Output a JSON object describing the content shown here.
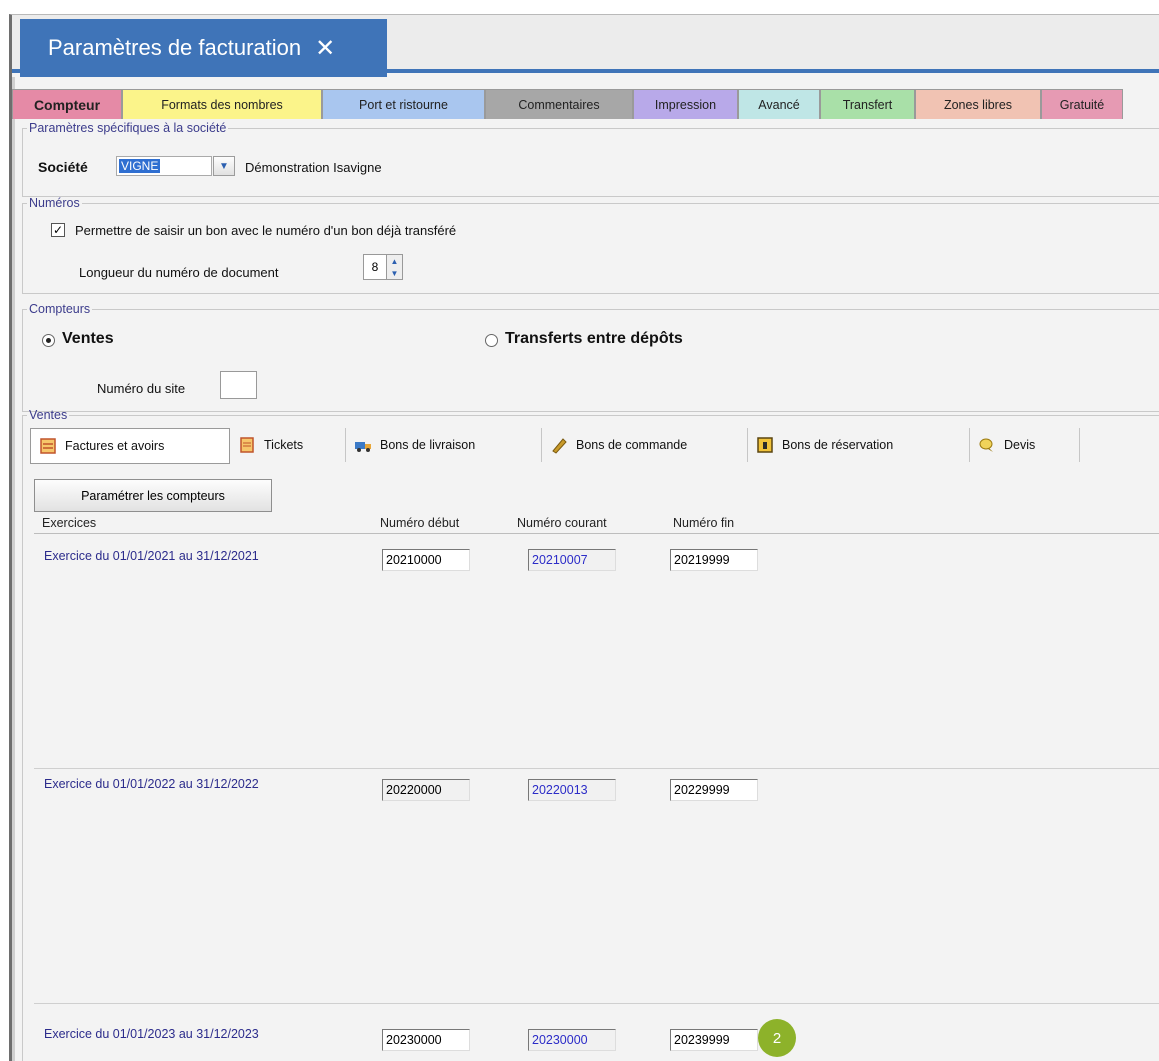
{
  "window": {
    "title": "Paramètres de facturation",
    "close_glyph": "✕"
  },
  "tabs": [
    {
      "label": "Compteur",
      "color": "#e58aa6",
      "active": true
    },
    {
      "label": "Formats des nombres",
      "color": "#fbf48a"
    },
    {
      "label": "Port et ristourne",
      "color": "#a9c6ef"
    },
    {
      "label": "Commentaires",
      "color": "#a7a7a7"
    },
    {
      "label": "Impression",
      "color": "#b8a9e9"
    },
    {
      "label": "Avancé",
      "color": "#bfe6e6"
    },
    {
      "label": "Transfert",
      "color": "#a9e0a8"
    },
    {
      "label": "Zones libres",
      "color": "#f1c3b3"
    },
    {
      "label": "Gratuité",
      "color": "#e69ab3"
    }
  ],
  "societe_group": {
    "legend": "Paramètres spécifiques à la société",
    "label": "Société",
    "value": "VIGNE",
    "description": "Démonstration Isavigne"
  },
  "numeros_group": {
    "legend": "Numéros",
    "checkbox_label": "Permettre de saisir un bon avec le numéro d'un bon déjà transféré",
    "checkbox_checked": true,
    "check_glyph": "✓",
    "length_label": "Longueur du numéro de document",
    "length_value": "8"
  },
  "compteurs_group": {
    "legend": "Compteurs",
    "radio_ventes": "Ventes",
    "radio_transferts": "Transferts entre dépôts",
    "selected": "ventes",
    "site_label": "Numéro du site",
    "site_value": ""
  },
  "ventes_group": {
    "legend": "Ventes",
    "subtabs": [
      {
        "label": "Factures et avoirs",
        "icon": "invoice-icon",
        "active": true
      },
      {
        "label": "Tickets",
        "icon": "ticket-icon"
      },
      {
        "label": "Bons de livraison",
        "icon": "delivery-truck-icon"
      },
      {
        "label": "Bons de commande",
        "icon": "order-pen-icon"
      },
      {
        "label": "Bons de réservation",
        "icon": "reservation-icon"
      },
      {
        "label": "Devis",
        "icon": "quote-icon"
      }
    ],
    "configure_button": "Paramétrer les compteurs",
    "columns": {
      "exercices": "Exercices",
      "debut": "Numéro début",
      "courant": "Numéro courant",
      "fin": "Numéro fin"
    },
    "rows": [
      {
        "label": "Exercice du 01/01/2021 au 31/12/2021",
        "debut": "20210000",
        "courant": "20210007",
        "fin": "20219999"
      },
      {
        "label": "Exercice du 01/01/2022 au 31/12/2022",
        "debut": "20220000",
        "courant": "20220013",
        "fin": "20229999"
      },
      {
        "label": "Exercice du 01/01/2023 au 31/12/2023",
        "debut": "20230000",
        "courant": "20230000",
        "fin": "20239999"
      }
    ]
  },
  "annotation": {
    "badge": "2",
    "color": "#8db22a"
  }
}
